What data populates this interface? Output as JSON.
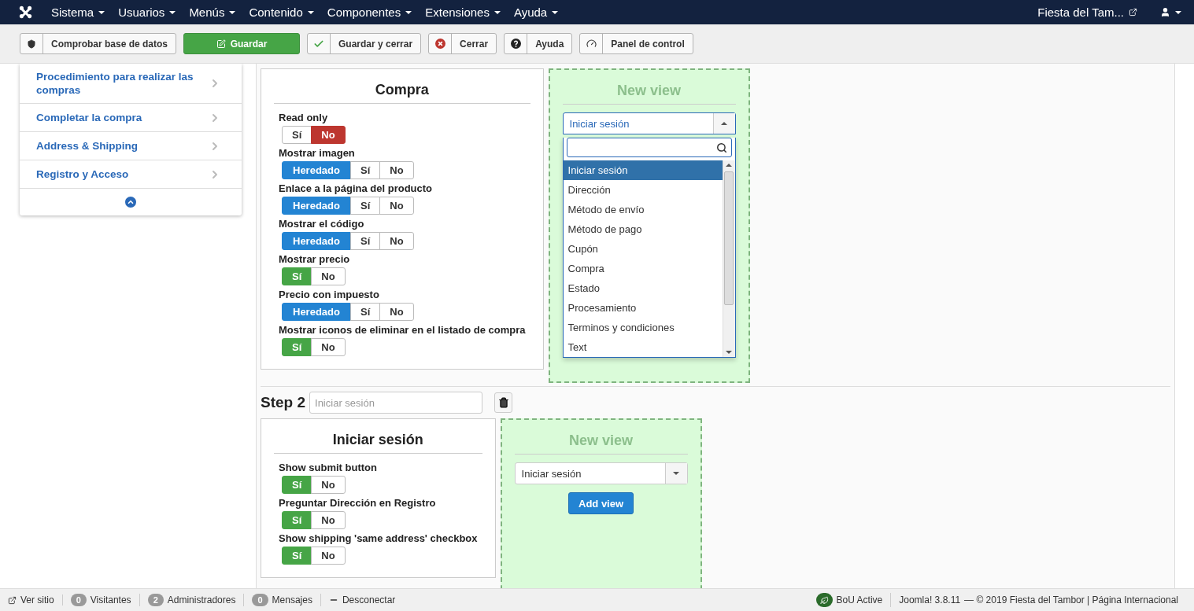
{
  "navbar": {
    "menus": [
      {
        "label": "Sistema"
      },
      {
        "label": "Usuarios"
      },
      {
        "label": "Menús"
      },
      {
        "label": "Contenido"
      },
      {
        "label": "Componentes"
      },
      {
        "label": "Extensiones"
      },
      {
        "label": "Ayuda"
      }
    ],
    "site_link": "Fiesta del Tam..."
  },
  "toolbar": [
    {
      "label": "Comprobar base de datos",
      "kind": "check-db"
    },
    {
      "label": "Guardar",
      "kind": "save"
    },
    {
      "label": "Guardar y cerrar",
      "kind": "save-close"
    },
    {
      "label": "Cerrar",
      "kind": "close"
    },
    {
      "label": "Ayuda",
      "kind": "help"
    },
    {
      "label": "Panel de control",
      "kind": "dashboard"
    }
  ],
  "sidebar": {
    "items": [
      {
        "label": "Procedimiento para realizar las compras"
      },
      {
        "label": "Completar la compra"
      },
      {
        "label": "Address & Shipping"
      },
      {
        "label": "Registro y Acceso"
      }
    ]
  },
  "steps": [
    {
      "views": [
        {
          "title": "Compra",
          "options": [
            {
              "label": "Read only",
              "choices": [
                {
                  "label": "Sí",
                  "kind": "yes",
                  "selected": false
                },
                {
                  "label": "No",
                  "kind": "no",
                  "selected": true
                }
              ]
            },
            {
              "label": "Mostrar imagen",
              "choices": [
                {
                  "label": "Heredado",
                  "kind": "inherit",
                  "selected": true
                },
                {
                  "label": "Sí",
                  "kind": "yes",
                  "selected": false
                },
                {
                  "label": "No",
                  "kind": "no",
                  "selected": false
                }
              ]
            },
            {
              "label": "Enlace a la página del producto",
              "choices": [
                {
                  "label": "Heredado",
                  "kind": "inherit",
                  "selected": true
                },
                {
                  "label": "Sí",
                  "kind": "yes",
                  "selected": false
                },
                {
                  "label": "No",
                  "kind": "no",
                  "selected": false
                }
              ]
            },
            {
              "label": "Mostrar el código",
              "choices": [
                {
                  "label": "Heredado",
                  "kind": "inherit",
                  "selected": true
                },
                {
                  "label": "Sí",
                  "kind": "yes",
                  "selected": false
                },
                {
                  "label": "No",
                  "kind": "no",
                  "selected": false
                }
              ]
            },
            {
              "label": "Mostrar precio",
              "choices": [
                {
                  "label": "Sí",
                  "kind": "yes",
                  "selected": true
                },
                {
                  "label": "No",
                  "kind": "no",
                  "selected": false
                }
              ]
            },
            {
              "label": "Precio con impuesto",
              "choices": [
                {
                  "label": "Heredado",
                  "kind": "inherit",
                  "selected": true
                },
                {
                  "label": "Sí",
                  "kind": "yes",
                  "selected": false
                },
                {
                  "label": "No",
                  "kind": "no",
                  "selected": false
                }
              ]
            },
            {
              "label": "Mostrar iconos de eliminar en el listado de compra",
              "choices": [
                {
                  "label": "Sí",
                  "kind": "yes",
                  "selected": true
                },
                {
                  "label": "No",
                  "kind": "no",
                  "selected": false
                }
              ]
            }
          ]
        }
      ],
      "new_view": {
        "title": "New view",
        "select": {
          "value": "Iniciar sesión",
          "expanded": true,
          "items": [
            {
              "label": "Iniciar sesión",
              "selected": true
            },
            {
              "label": "Dirección",
              "selected": false
            },
            {
              "label": "Método de envío",
              "selected": false
            },
            {
              "label": "Método de pago",
              "selected": false
            },
            {
              "label": "Cupón",
              "selected": false
            },
            {
              "label": "Compra",
              "selected": false
            },
            {
              "label": "Estado",
              "selected": false
            },
            {
              "label": "Procesamiento",
              "selected": false
            },
            {
              "label": "Terminos y condiciones",
              "selected": false
            },
            {
              "label": "Text",
              "selected": false
            }
          ]
        }
      }
    },
    {
      "label": "Step 2",
      "name_placeholder": "Iniciar sesión",
      "views": [
        {
          "title": "Iniciar sesión",
          "options": [
            {
              "label": "Show submit button",
              "choices": [
                {
                  "label": "Sí",
                  "kind": "yes",
                  "selected": true
                },
                {
                  "label": "No",
                  "kind": "no",
                  "selected": false
                }
              ]
            },
            {
              "label": "Preguntar Dirección en Registro",
              "choices": [
                {
                  "label": "Sí",
                  "kind": "yes",
                  "selected": true
                },
                {
                  "label": "No",
                  "kind": "no",
                  "selected": false
                }
              ]
            },
            {
              "label": "Show shipping 'same address' checkbox",
              "choices": [
                {
                  "label": "Sí",
                  "kind": "yes",
                  "selected": true
                },
                {
                  "label": "No",
                  "kind": "no",
                  "selected": false
                }
              ]
            }
          ]
        }
      ],
      "new_view": {
        "title": "New view",
        "select": {
          "value": "Iniciar sesión",
          "expanded": false
        },
        "button": "Add view"
      }
    }
  ],
  "status_bar": {
    "left": [
      {
        "kind": "link",
        "label": "Ver sitio"
      },
      {
        "kind": "count",
        "count": "0",
        "label": "Visitantes"
      },
      {
        "kind": "count",
        "count": "2",
        "label": "Administradores"
      },
      {
        "kind": "count",
        "count": "0",
        "label": "Mensajes"
      },
      {
        "kind": "logout",
        "label": "Desconectar"
      }
    ],
    "badge": "BoU Active",
    "version": "Joomla! 3.8.11",
    "footer": "— © 2019 Fiesta del Tambor | Página Internacional"
  }
}
